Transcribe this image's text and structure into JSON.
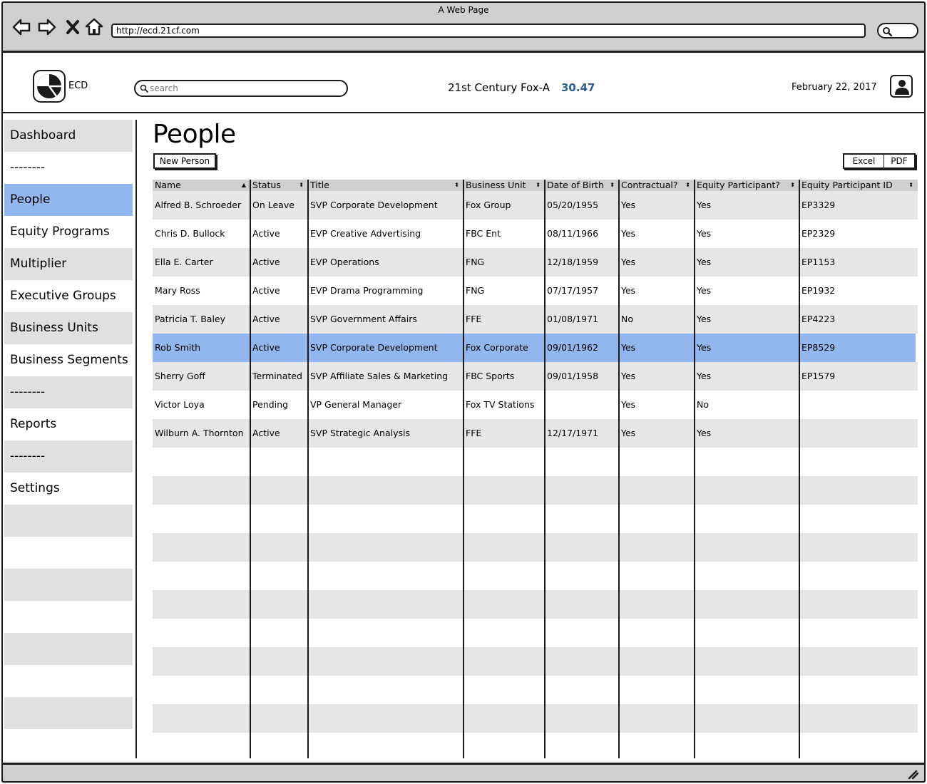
{
  "browser": {
    "window_title": "A Web Page",
    "url": "http://ecd.21cf.com"
  },
  "header": {
    "logo_text": "ECD",
    "search_placeholder": "search",
    "ticker_name": "21st Century Fox-A",
    "ticker_value": "30.47",
    "date": "February 22, 2017"
  },
  "sidebar": {
    "items": [
      {
        "label": "Dashboard",
        "style": "shade"
      },
      {
        "label": "--------",
        "style": "plain"
      },
      {
        "label": "People",
        "style": "active"
      },
      {
        "label": "Equity Programs",
        "style": "plain"
      },
      {
        "label": "Multiplier",
        "style": "shade"
      },
      {
        "label": "Executive Groups",
        "style": "plain"
      },
      {
        "label": "Business Units",
        "style": "shade"
      },
      {
        "label": "Business Segments",
        "style": "plain"
      },
      {
        "label": "--------",
        "style": "shade"
      },
      {
        "label": "Reports",
        "style": "plain"
      },
      {
        "label": "--------",
        "style": "shade"
      },
      {
        "label": "Settings",
        "style": "plain"
      },
      {
        "label": "",
        "style": "shade"
      },
      {
        "label": "",
        "style": "plain"
      },
      {
        "label": "",
        "style": "shade"
      },
      {
        "label": "",
        "style": "plain"
      },
      {
        "label": "",
        "style": "shade"
      },
      {
        "label": "",
        "style": "plain"
      },
      {
        "label": "",
        "style": "shade"
      }
    ]
  },
  "main": {
    "title": "People",
    "new_button": "New Person",
    "export_excel": "Excel",
    "export_pdf": "PDF"
  },
  "table": {
    "columns": [
      {
        "label": "Name",
        "sort": "▲"
      },
      {
        "label": "Status",
        "sort": "⬍"
      },
      {
        "label": "Title",
        "sort": "⬍"
      },
      {
        "label": "Business Unit",
        "sort": "⬍"
      },
      {
        "label": "Date of Birth",
        "sort": "⬍"
      },
      {
        "label": "Contractual?",
        "sort": "⬍"
      },
      {
        "label": "Equity Participant?",
        "sort": "⬍"
      },
      {
        "label": "Equity Participant ID",
        "sort": "⬍"
      }
    ],
    "rows": [
      [
        "Alfred B. Schroeder",
        "On Leave",
        "SVP Corporate Development",
        "Fox Group",
        "05/20/1955",
        "Yes",
        "Yes",
        "EP3329"
      ],
      [
        "Chris D. Bullock",
        "Active",
        "EVP Creative Advertising",
        "FBC Ent",
        "08/11/1966",
        "Yes",
        "Yes",
        "EP2329"
      ],
      [
        "Ella E. Carter",
        "Active",
        "EVP Operations",
        "FNG",
        "12/18/1959",
        "Yes",
        "Yes",
        "EP1153"
      ],
      [
        "Mary Ross",
        "Active",
        "EVP Drama Programming",
        "FNG",
        "07/17/1957",
        "Yes",
        "Yes",
        "EP1932"
      ],
      [
        "Patricia T. Baley",
        "Active",
        "SVP Government Affairs",
        "FFE",
        "01/08/1971",
        "No",
        "Yes",
        "EP4223"
      ],
      [
        "Rob Smith",
        "Active",
        "SVP Corporate Development",
        "Fox Corporate",
        "09/01/1962",
        "Yes",
        "Yes",
        "EP8529"
      ],
      [
        "Sherry Goff",
        "Terminated",
        "SVP Affiliate Sales & Marketing",
        "FBC Sports",
        "09/01/1958",
        "Yes",
        "Yes",
        "EP1579"
      ],
      [
        "Victor Loya",
        "Pending",
        "VP General Manager",
        "Fox TV Stations",
        "",
        "Yes",
        "No",
        ""
      ],
      [
        "Wilburn A. Thornton",
        "Active",
        "SVP Strategic Analysis",
        "FFE",
        "12/17/1971",
        "Yes",
        "Yes",
        ""
      ]
    ],
    "selected_row": 5,
    "empty_rows": 10
  },
  "colors": {
    "selection": "#92b6ee",
    "ticker_value": "#2f5d8e",
    "row_shade": "#e6e6e6",
    "chrome": "#cfcfcf"
  },
  "icons": [
    "back-icon",
    "forward-icon",
    "close-icon",
    "home-icon",
    "search-icon",
    "logo-pie-icon",
    "user-icon",
    "resize-grip-icon"
  ]
}
